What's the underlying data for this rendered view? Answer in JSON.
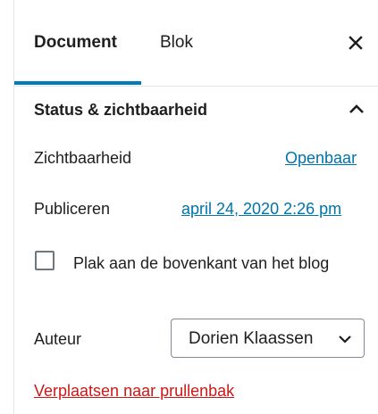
{
  "sidebar": {
    "tabs": [
      {
        "label": "Document",
        "active": true
      },
      {
        "label": "Blok",
        "active": false
      }
    ],
    "close_icon": "close-icon",
    "accent_color": "#007cba"
  },
  "status_section": {
    "title": "Status & zichtbaarheid",
    "expanded": true,
    "toggle_icon": "chevron-up-icon",
    "visibility": {
      "label": "Zichtbaarheid",
      "value": "Openbaar"
    },
    "publish": {
      "label": "Publiceren",
      "value": "april 24, 2020 2:26 pm"
    },
    "sticky": {
      "label": "Plak aan de bovenkant van het blog",
      "checked": false
    },
    "author": {
      "label": "Auteur",
      "selected": "Dorien Klaassen",
      "icon": "chevron-down-icon"
    },
    "trash": {
      "label": "Verplaatsen naar prullenbak",
      "color": "#cc1818"
    },
    "link_color": "#0073aa"
  }
}
